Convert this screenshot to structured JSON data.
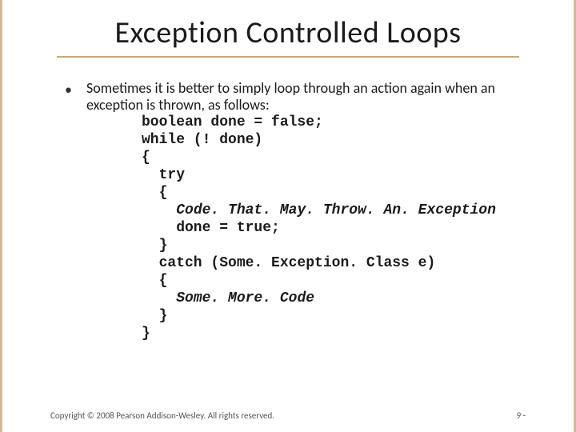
{
  "slide": {
    "title": "Exception Controlled Loops",
    "bullet_text": "Sometimes it is better to simply loop through an action again when an exception is thrown, as follows:",
    "code": {
      "l1": "boolean done = false;",
      "l2": "while (! done)",
      "l3": "{",
      "l4": "  try",
      "l5": "  {",
      "l6_indent": "    ",
      "l6_italic": "Code. That. May. Throw. An. Exception",
      "l7": "    done = true;",
      "l8": "  }",
      "l9": "  catch (Some. Exception. Class e)",
      "l10": "  {",
      "l11_indent": "    ",
      "l11_italic": "Some. More. Code",
      "l12": "  }",
      "l13": "}"
    },
    "copyright": "Copyright © 2008 Pearson Addison-Wesley. All rights reserved.",
    "page_num": "9 -"
  }
}
